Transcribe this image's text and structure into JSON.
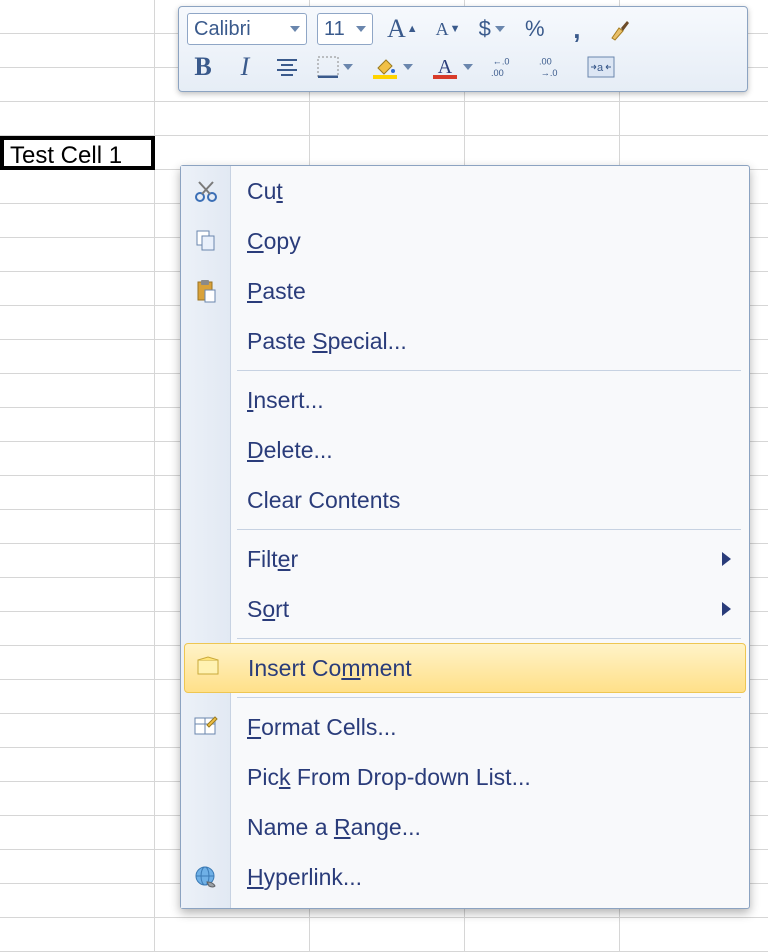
{
  "toolbar": {
    "font_name": "Calibri",
    "font_size": "11",
    "grow_font": "A",
    "shrink_font": "A",
    "currency": "$",
    "percent": "%",
    "comma": ",",
    "bold": "B",
    "italic": "I",
    "increase_dec": ".0",
    "increase_dec2": ".00",
    "decrease_dec": ".00",
    "decrease_dec2": ".0",
    "font_color_letter": "A",
    "fill_color_icon": "◆"
  },
  "cells": {
    "a1": "Test Cell 1"
  },
  "menu": {
    "cut": "Cut",
    "copy": "Copy",
    "paste": "Paste",
    "paste_special": "Paste Special...",
    "insert": "Insert...",
    "delete": "Delete...",
    "clear_contents": "Clear Contents",
    "filter": "Filter",
    "sort": "Sort",
    "insert_comment": "Insert Comment",
    "format_cells": "Format Cells...",
    "pick_from_list": "Pick From Drop-down List...",
    "name_range": "Name a Range...",
    "hyperlink": "Hyperlink..."
  }
}
